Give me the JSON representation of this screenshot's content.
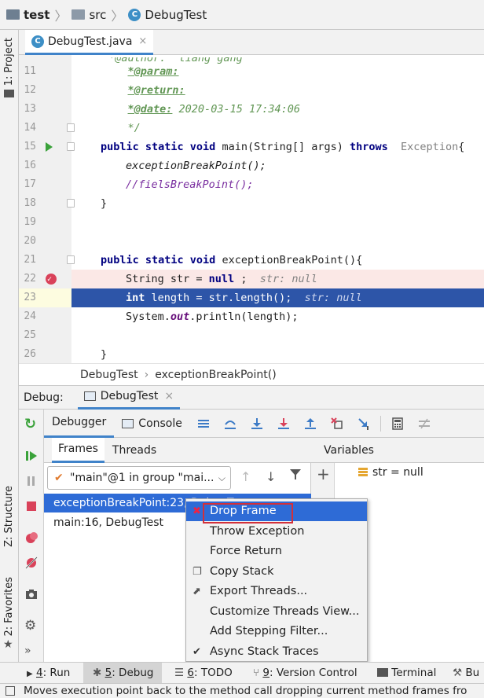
{
  "navbar": {
    "crumbs": [
      "test",
      "src",
      "DebugTest"
    ]
  },
  "left_strip": {
    "project_label": "1: Project",
    "structure_label": "Z: Structure",
    "favorites_label": "2: Favorites"
  },
  "editor_tab": {
    "label": "DebugTest.java",
    "close": "×"
  },
  "editor": {
    "lines": [
      {
        "n": "11",
        "text": "*@param:"
      },
      {
        "n": "12",
        "text": "*@return:"
      },
      {
        "n": "13",
        "tag": "*@date:",
        "text": " 2020-03-15 17:34:06"
      },
      {
        "n": "14",
        "text": "*/"
      },
      {
        "n": "15",
        "kw": "public static void",
        "text": " main(String[] args) ",
        "kw2": "throws",
        "hint": "Exception",
        "end": "{"
      },
      {
        "n": "16",
        "text": "exceptionBreakPoint();"
      },
      {
        "n": "17",
        "text": "//fielsBreakPoint();"
      },
      {
        "n": "18",
        "text": "}"
      },
      {
        "n": "19",
        "text": ""
      },
      {
        "n": "20",
        "text": ""
      },
      {
        "n": "21",
        "kw": "public static void",
        "text": " exceptionBreakPoint(){"
      },
      {
        "n": "22",
        "text": "String str = ",
        "kw": "null",
        "text2": " ;",
        "hint": "str: null"
      },
      {
        "n": "23",
        "kw": "int",
        "text": " length = str.length();",
        "hint": "str: null"
      },
      {
        "n": "24",
        "text": "System.",
        "fld": "out",
        "text2": ".println(length);"
      },
      {
        "n": "25",
        "text": ""
      },
      {
        "n": "26",
        "text": "}"
      }
    ]
  },
  "editor_breadcrumb": {
    "cls": "DebugTest",
    "sep": "›",
    "method": "exceptionBreakPoint()"
  },
  "debug_header": {
    "label": "Debug:",
    "tab": "DebugTest",
    "close": "×"
  },
  "debug_toolbar": {
    "debugger": "Debugger",
    "console": "Console"
  },
  "frames": {
    "tab_frames": "Frames",
    "tab_threads": "Threads",
    "thread": "\"main\"@1 in group \"mai...",
    "rows": [
      "exceptionBreakPoint:23, DebugTest",
      "main:16, DebugTest"
    ]
  },
  "variables": {
    "title": "Variables",
    "rows": [
      {
        "name": "str",
        "value": "null"
      }
    ],
    "eq": " = "
  },
  "context_menu": {
    "items": [
      "Drop Frame",
      "Throw Exception",
      "Force Return",
      "Copy Stack",
      "Export Threads...",
      "Customize Threads View...",
      "Add Stepping Filter...",
      "Async Stack Traces"
    ],
    "selected": "Drop Frame"
  },
  "bottom_tools": {
    "run": {
      "key": "4",
      "label": ": Run"
    },
    "debug": {
      "key": "5",
      "label": ": Debug"
    },
    "todo": {
      "key": "6",
      "label": ": TODO"
    },
    "vcs": {
      "key": "9",
      "label": ": Version Control"
    },
    "terminal": {
      "label": "Terminal"
    },
    "build": {
      "label": "Bu"
    }
  },
  "status": {
    "text": "Moves execution point back to the method call dropping current method frames fro"
  },
  "colors": {
    "accent": "#4083c9",
    "selection": "#2e6bd6",
    "exec_line": "#2d55a8",
    "breakpoint": "#d9425a"
  }
}
